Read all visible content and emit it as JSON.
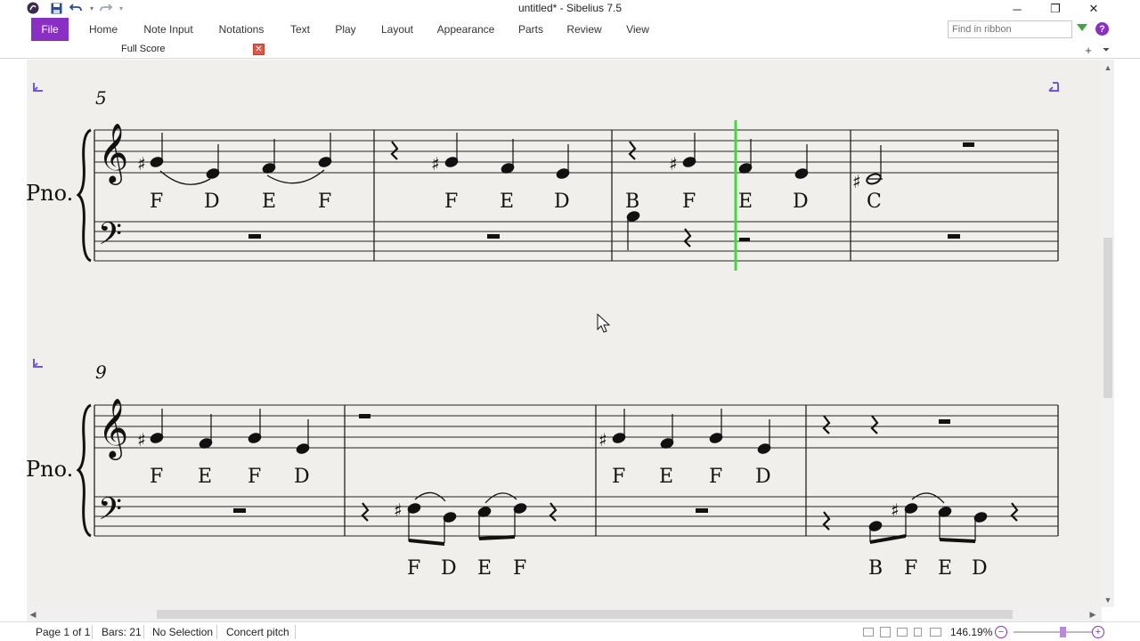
{
  "window": {
    "title": "untitled* - Sibelius 7.5"
  },
  "quick_access": {
    "save_icon": "save-icon",
    "undo_icon": "undo-icon",
    "redo_icon": "redo-icon"
  },
  "window_controls": {
    "minimize": "─",
    "restore": "❐",
    "close": "✕"
  },
  "ribbon": {
    "tabs": [
      {
        "label": "File"
      },
      {
        "label": "Home"
      },
      {
        "label": "Note Input"
      },
      {
        "label": "Notations"
      },
      {
        "label": "Text"
      },
      {
        "label": "Play"
      },
      {
        "label": "Layout"
      },
      {
        "label": "Appearance"
      },
      {
        "label": "Parts"
      },
      {
        "label": "Review"
      },
      {
        "label": "View"
      }
    ],
    "search_placeholder": "Find in ribbon",
    "help_label": "?"
  },
  "document_tab": {
    "label": "Full Score",
    "close": "✕"
  },
  "score": {
    "instrument": "Pno.",
    "systems": [
      {
        "bar_number": "5",
        "treble_labels": [
          "F",
          "D",
          "E",
          "F",
          "F",
          "E",
          "D",
          "B",
          "F",
          "E",
          "D",
          "C"
        ],
        "bass_labels": []
      },
      {
        "bar_number": "9",
        "treble_labels": [
          "F",
          "E",
          "F",
          "D",
          "F",
          "E",
          "F",
          "D"
        ],
        "bass_labels": [
          "F",
          "D",
          "E",
          "F",
          "B",
          "F",
          "E",
          "D"
        ]
      }
    ],
    "playback_line_color": "#3ddc3d",
    "accent_color": "#8a2fc3"
  },
  "status": {
    "page": "Page 1 of 1",
    "bars": "Bars: 21",
    "selection": "No Selection",
    "pitch": "Concert pitch",
    "zoom": "146.19%"
  }
}
